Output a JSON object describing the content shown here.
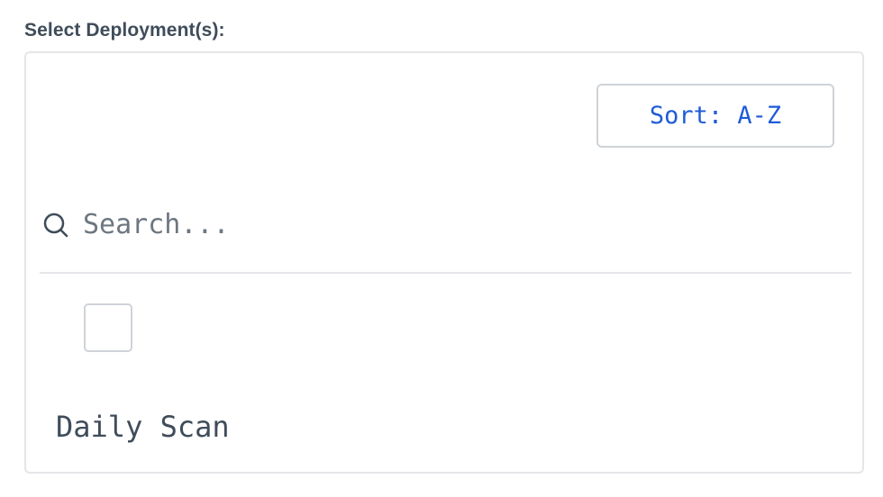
{
  "field": {
    "label": "Select Deployment(s):"
  },
  "sort": {
    "label": "Sort: A-Z"
  },
  "search": {
    "placeholder": "Search...",
    "value": "",
    "icon": "search-icon"
  },
  "items": [
    {
      "label": "Daily Scan",
      "checked": false
    }
  ],
  "colors": {
    "label_text": "#3f4c5a",
    "accent": "#1e5bd8",
    "border": "#e4e6e9",
    "placeholder": "#6e7780"
  }
}
